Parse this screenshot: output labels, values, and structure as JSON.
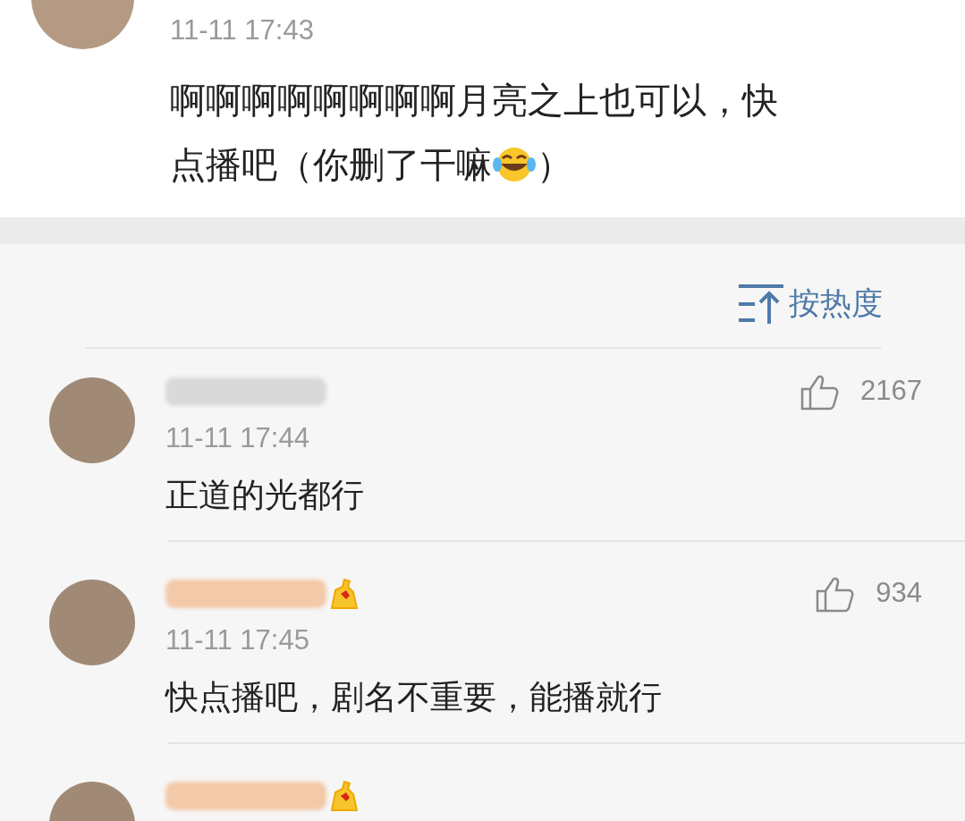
{
  "post": {
    "time": "11-11 17:43",
    "line_1": "啊啊啊啊啊啊啊啊月亮之上也可以，快",
    "text_before_emoji": "点播吧（你删了干嘛",
    "text_after_emoji": "）"
  },
  "sort_button": {
    "label": "按热度"
  },
  "comments": [
    {
      "likes": "2167",
      "time": "11-11 17:44",
      "text": "正道的光都行",
      "badge": false
    },
    {
      "likes": "934",
      "time": "11-11 17:45",
      "text": "快点播吧，剧名不重要，能播就行",
      "badge": true
    },
    {
      "badge": true
    }
  ]
}
